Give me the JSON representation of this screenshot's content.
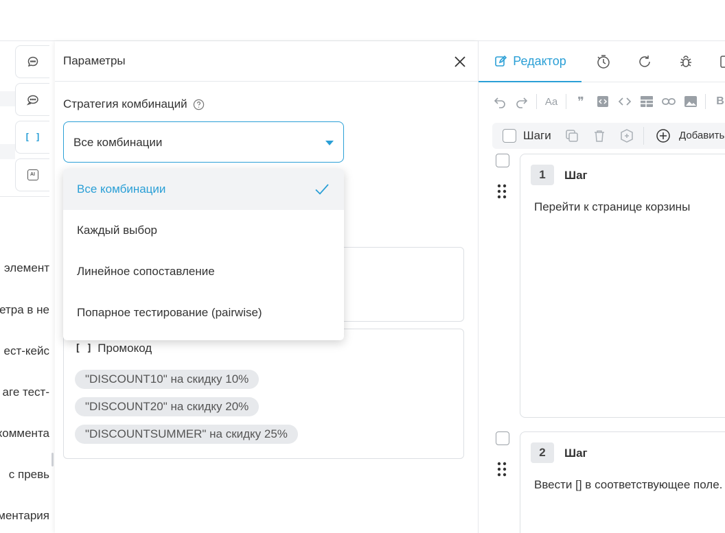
{
  "left_list": {
    "items": [
      "элемент",
      "етра в не",
      "ест-кейс",
      "аге тест-",
      "коммента",
      "с превь",
      "ментария"
    ]
  },
  "rail": {
    "icons": [
      "comment-icon",
      "chat-icon",
      "brackets-icon",
      "ai-chip-icon"
    ],
    "brackets_glyph": "[ ]",
    "ai_glyph": "AI"
  },
  "panel": {
    "title": "Параметры",
    "strategy_label": "Стратегия комбинаций",
    "select_value": "Все комбинации",
    "dropdown_options": [
      "Все комбинации",
      "Каждый выбор",
      "Линейное сопоставление",
      "Попарное тестирование (pairwise)"
    ],
    "selected_index": 0,
    "param_card": {
      "icon_glyph": "[ ]",
      "name": "Промокод",
      "values": [
        "\"DISCOUNT10\" на скидку 10%",
        "\"DISCOUNT20\" на скидку 20%",
        "\"DISCOUNTSUMMER\" на скидку 25%"
      ]
    }
  },
  "editor": {
    "tab_label": "Редактор",
    "tab_icons": [
      "edit-icon",
      "history-icon",
      "refresh-icon",
      "bug-icon",
      "document-icon"
    ],
    "toolbar_text": {
      "font": "Aa",
      "quote": "❞",
      "bold": "B"
    },
    "steps_label": "Шаги",
    "add_label": "Добавить",
    "steps": [
      {
        "number": "1",
        "label": "Шаг",
        "text": "Перейти к странице корзины"
      },
      {
        "number": "2",
        "label": "Шаг",
        "text": "Ввести [] в соответствующее поле."
      }
    ]
  },
  "colors": {
    "accent": "#2a9fd6",
    "chip_bg": "#e7e9ec",
    "border": "#dcdfe3"
  }
}
